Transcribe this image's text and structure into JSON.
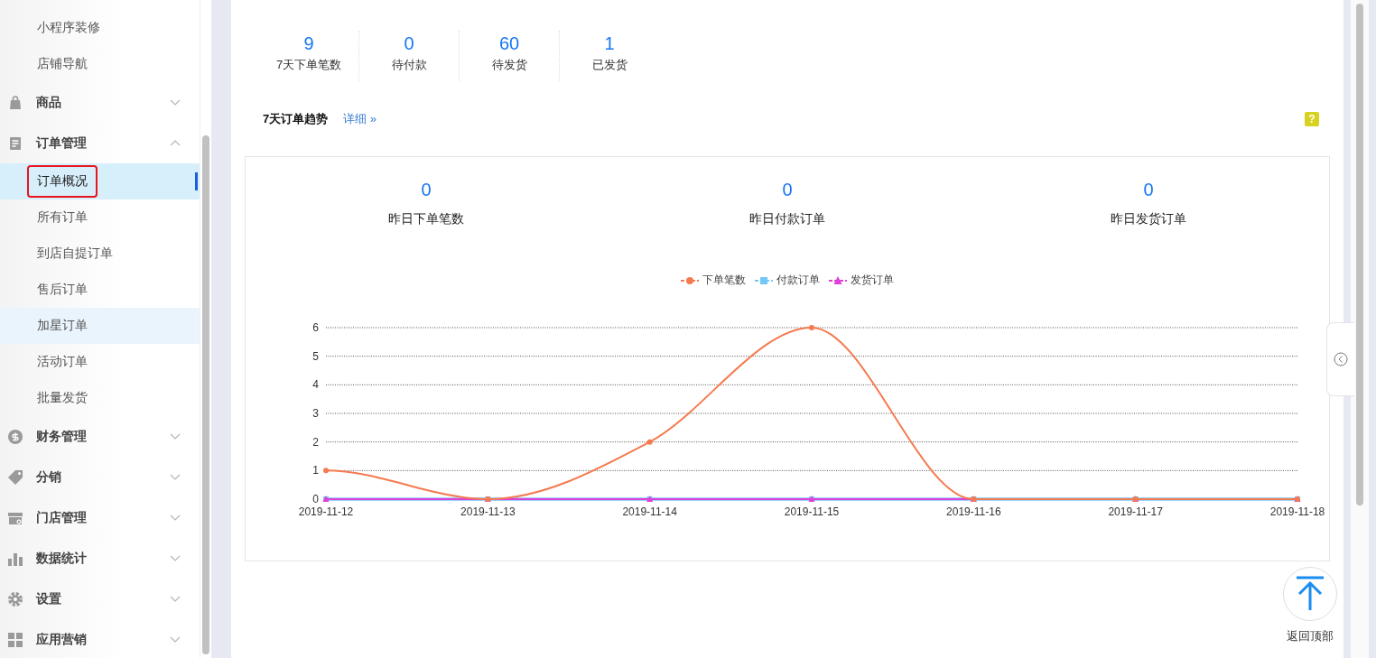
{
  "sidebar": {
    "leading_items": [
      {
        "label": "小程序装修",
        "selected": false,
        "highlighted": false
      },
      {
        "label": "店铺导航",
        "selected": false,
        "highlighted": false
      }
    ],
    "groups": [
      {
        "label": "商品",
        "expanded": false
      },
      {
        "label": "订单管理",
        "expanded": true,
        "children": [
          {
            "label": "订单概况",
            "selected": true,
            "highlighted": false,
            "annotated": true
          },
          {
            "label": "所有订单",
            "selected": false,
            "highlighted": false,
            "annotated": false
          },
          {
            "label": "到店自提订单",
            "selected": false,
            "highlighted": false,
            "annotated": false
          },
          {
            "label": "售后订单",
            "selected": false,
            "highlighted": false,
            "annotated": false
          },
          {
            "label": "加星订单",
            "selected": false,
            "highlighted": true,
            "annotated": false
          },
          {
            "label": "活动订单",
            "selected": false,
            "highlighted": false,
            "annotated": false
          },
          {
            "label": "批量发货",
            "selected": false,
            "highlighted": false,
            "annotated": false
          }
        ]
      },
      {
        "label": "财务管理",
        "expanded": false
      },
      {
        "label": "分销",
        "expanded": false
      },
      {
        "label": "门店管理",
        "expanded": false
      },
      {
        "label": "数据统计",
        "expanded": false
      },
      {
        "label": "设置",
        "expanded": false
      },
      {
        "label": "应用营销",
        "expanded": false
      }
    ]
  },
  "stats": [
    {
      "value": "9",
      "label": "7天下单笔数"
    },
    {
      "value": "0",
      "label": "待付款"
    },
    {
      "value": "60",
      "label": "待发货"
    },
    {
      "value": "1",
      "label": "已发货"
    }
  ],
  "trend": {
    "title": "7天订单趋势",
    "detail_link": "详细 »",
    "help": "?",
    "summary": [
      {
        "value": "0",
        "label": "昨日下单笔数"
      },
      {
        "value": "0",
        "label": "昨日付款订单"
      },
      {
        "value": "0",
        "label": "昨日发货订单"
      }
    ],
    "chart_data": {
      "type": "line",
      "categories": [
        "2019-11-12",
        "2019-11-13",
        "2019-11-14",
        "2019-11-15",
        "2019-11-16",
        "2019-11-17",
        "2019-11-18"
      ],
      "ylim": [
        0,
        6
      ],
      "grid": true,
      "yticks": [
        0,
        1,
        2,
        3,
        4,
        5,
        6
      ],
      "series": [
        {
          "name": "下单笔数",
          "color": "#f57a4f",
          "marker": "circle",
          "values": [
            1,
            0,
            2,
            6,
            0,
            0,
            0
          ]
        },
        {
          "name": "付款订单",
          "color": "#73c8f7",
          "marker": "square",
          "values": [
            0,
            0,
            0,
            0,
            0,
            0,
            0
          ]
        },
        {
          "name": "发货订单",
          "color": "#e040d8",
          "marker": "triangle",
          "values": [
            0,
            0,
            0,
            0,
            0,
            0,
            0
          ]
        }
      ]
    }
  },
  "back_to_top": {
    "label": "返回顶部"
  }
}
